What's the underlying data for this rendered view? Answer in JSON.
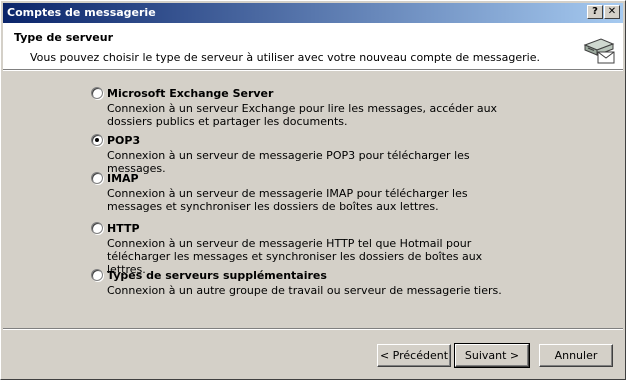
{
  "window": {
    "title": "Comptes de messagerie",
    "help_button": "?",
    "close_button": "✕"
  },
  "header": {
    "title": "Type de serveur",
    "subtitle": "Vous pouvez choisir le type de serveur à utiliser avec votre nouveau compte de messagerie.",
    "icon": "mail-server-icon"
  },
  "options": [
    {
      "label": "Microsoft Exchange Server",
      "description": "Connexion à un serveur Exchange pour lire les messages, accéder aux dossiers publics et partager les documents.",
      "selected": false
    },
    {
      "label": "POP3",
      "description": "Connexion à un serveur de messagerie POP3 pour télécharger les messages.",
      "selected": true
    },
    {
      "label": "IMAP",
      "description": "Connexion à un serveur de messagerie IMAP pour télécharger les messages et synchroniser les dossiers de boîtes aux lettres.",
      "selected": false
    },
    {
      "label": "HTTP",
      "description": "Connexion à un serveur de messagerie HTTP tel que Hotmail pour télécharger les messages et synchroniser les dossiers de boîtes aux lettres.",
      "selected": false
    },
    {
      "label": "Types de serveurs supplémentaires",
      "description": "Connexion à un autre groupe de travail ou serveur de messagerie tiers.",
      "selected": false
    }
  ],
  "buttons": {
    "back": "< Précédent",
    "next": "Suivant >",
    "cancel": "Annuler"
  }
}
